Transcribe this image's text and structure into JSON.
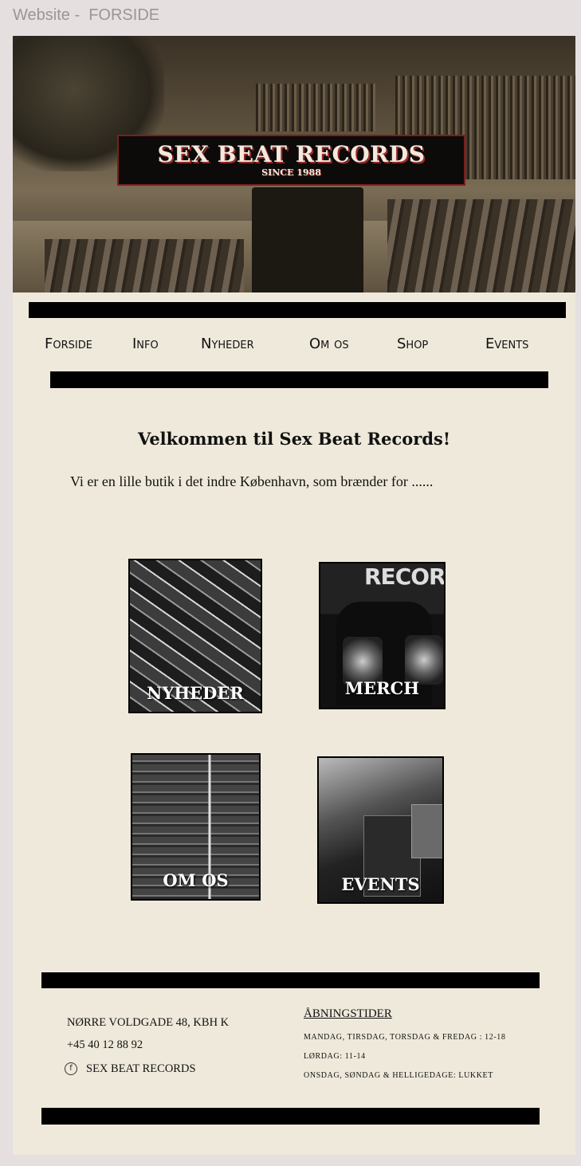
{
  "frame": {
    "label": "Website -  FORSIDE"
  },
  "hero": {
    "sign_title": "SEX BEAT RECORDS",
    "sign_subtitle": "SINCE 1988"
  },
  "nav": {
    "items": [
      {
        "label": "Forside"
      },
      {
        "label": "Info"
      },
      {
        "label": "Nyheder"
      },
      {
        "label": "Om os"
      },
      {
        "label": "Shop"
      },
      {
        "label": "Events"
      }
    ]
  },
  "main": {
    "welcome": "Velkommen til Sex Beat Records!",
    "intro": "Vi er en lille butik i det indre København, som brænder for ......"
  },
  "cards": [
    {
      "label": "NYHEDER"
    },
    {
      "label": "MERCH",
      "photo_text": "RECORDS"
    },
    {
      "label": "OM OS"
    },
    {
      "label": "EVENTS"
    }
  ],
  "footer": {
    "address": "NØRRE VOLDGADE 48, KBH K",
    "phone": "+45 40 12 88 92",
    "facebook": "SEX BEAT RECORDS",
    "hours_title": "ÅBNINGSTIDER",
    "hours": [
      "MANDAG, TIRSDAG, TORSDAG & FREDAG :  12-18",
      "LØRDAG:  11-14",
      "ONSDAG, SØNDAG & HELLIGEDAGE:  LUKKET"
    ]
  },
  "colors": {
    "page_background": "#eee9da",
    "canvas_background": "#e6dfe0",
    "bars": "#000000",
    "sign_border": "#7a1f1f"
  },
  "icons": {
    "facebook": "facebook-icon"
  }
}
